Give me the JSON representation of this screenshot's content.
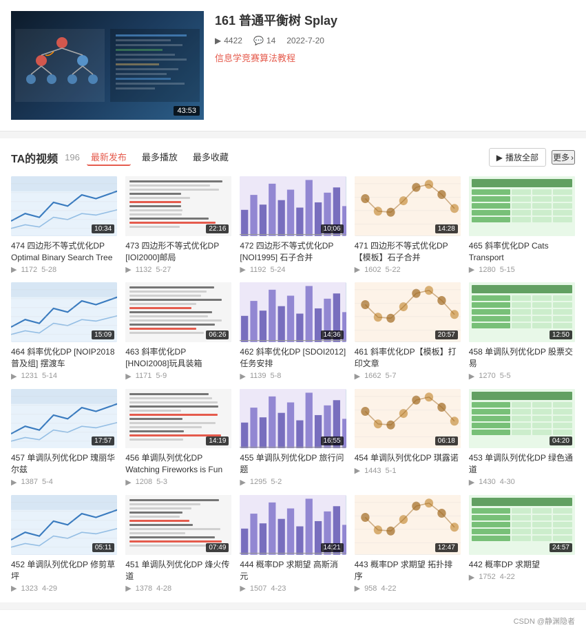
{
  "topVideo": {
    "title": "161 普通平衡树 Splay",
    "views": "4422",
    "comments": "14",
    "date": "2022-7-20",
    "tag": "信息学竞赛算法教程",
    "duration": "43:53",
    "thumbTheme": "dark"
  },
  "taSection": {
    "title": "TA的视频",
    "count": "196",
    "tabs": [
      "最新发布",
      "最多播放",
      "最多收藏"
    ],
    "activeTab": 0,
    "playAllLabel": "播放全部",
    "moreLabel": "更多"
  },
  "videos": [
    {
      "id": "v1",
      "title": "474 四边形不等式优化DP Optimal Binary Search Tree",
      "duration": "10:34",
      "views": "1172",
      "date": "5-28",
      "theme": "t1"
    },
    {
      "id": "v2",
      "title": "473 四边形不等式优化DP [IOI2000]邮局",
      "duration": "22:16",
      "views": "1132",
      "date": "5-27",
      "theme": "t2"
    },
    {
      "id": "v3",
      "title": "472 四边形不等式优化DP [NOI1995] 石子合并",
      "duration": "10:06",
      "views": "1192",
      "date": "5-24",
      "theme": "t3"
    },
    {
      "id": "v4",
      "title": "471 四边形不等式优化DP 【模板】石子合并",
      "duration": "14:28",
      "views": "1602",
      "date": "5-22",
      "theme": "t4"
    },
    {
      "id": "v5",
      "title": "465 斜率优化DP Cats Transport",
      "duration": "",
      "views": "1280",
      "date": "5-15",
      "theme": "t5"
    },
    {
      "id": "v6",
      "title": "464 斜率优化DP [NOIP2018 普及组] 摆渡车",
      "duration": "15:09",
      "views": "1231",
      "date": "5-14",
      "theme": "t1"
    },
    {
      "id": "v7",
      "title": "463 斜率优化DP [HNOI2008]玩具装箱",
      "duration": "06:26",
      "views": "1171",
      "date": "5-9",
      "theme": "t2"
    },
    {
      "id": "v8",
      "title": "462 斜率优化DP [SDOI2012] 任务安排",
      "duration": "14:36",
      "views": "1139",
      "date": "5-8",
      "theme": "t3"
    },
    {
      "id": "v9",
      "title": "461 斜率优化DP【模板】打印文章",
      "duration": "20:57",
      "views": "1662",
      "date": "5-7",
      "theme": "t4"
    },
    {
      "id": "v10",
      "title": "458 单调队列优化DP 股票交易",
      "duration": "12:50",
      "views": "1270",
      "date": "5-5",
      "theme": "t5"
    },
    {
      "id": "v11",
      "title": "457 单调队列优化DP 瑰丽华尔兹",
      "duration": "17:57",
      "views": "1387",
      "date": "5-4",
      "theme": "t1"
    },
    {
      "id": "v12",
      "title": "456 单调队列优化DP Watching Fireworks is Fun",
      "duration": "14:19",
      "views": "1208",
      "date": "5-3",
      "theme": "t2"
    },
    {
      "id": "v13",
      "title": "455 单调队列优化DP 旅行问题",
      "duration": "16:55",
      "views": "1295",
      "date": "5-2",
      "theme": "t3"
    },
    {
      "id": "v14",
      "title": "454 单调队列优化DP 琪露诺",
      "duration": "06:18",
      "views": "1443",
      "date": "5-1",
      "theme": "t4"
    },
    {
      "id": "v15",
      "title": "453 单调队列优化DP 绿色通道",
      "duration": "04:20",
      "views": "1430",
      "date": "4-30",
      "theme": "t5"
    },
    {
      "id": "v16",
      "title": "452 单调队列优化DP 修剪草坪",
      "duration": "05:11",
      "views": "1323",
      "date": "4-29",
      "theme": "t1"
    },
    {
      "id": "v17",
      "title": "451 单调队列优化DP 烽火传道",
      "duration": "07:49",
      "views": "1378",
      "date": "4-28",
      "theme": "t2"
    },
    {
      "id": "v18",
      "title": "444 概率DP 求期望 高斯消元",
      "duration": "14:21",
      "views": "1507",
      "date": "4-23",
      "theme": "t3"
    },
    {
      "id": "v19",
      "title": "443 概率DP 求期望 拓扑排序",
      "duration": "12:47",
      "views": "958",
      "date": "4-22",
      "theme": "t4"
    },
    {
      "id": "v20",
      "title": "442 概率DP 求期望",
      "duration": "24:57",
      "views": "1752",
      "date": "4-22",
      "theme": "t5"
    }
  ],
  "footer": {
    "text": "CSDN @静渊隐者"
  },
  "icons": {
    "play": "▶",
    "comment": "💬",
    "chevron": "›",
    "eye": "👁"
  }
}
